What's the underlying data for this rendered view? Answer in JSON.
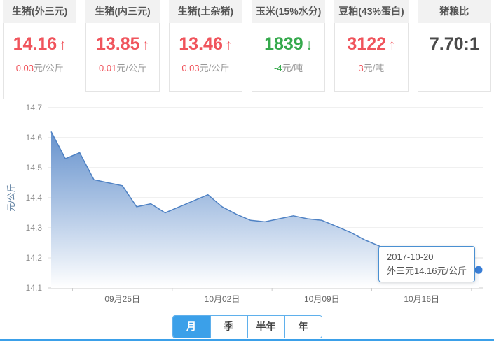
{
  "cards": [
    {
      "title": "生猪(外三元)",
      "value": "14.16",
      "arrow": "↑",
      "trend": "up",
      "change": "0.03",
      "unit": "元/公斤",
      "selected": true
    },
    {
      "title": "生猪(内三元)",
      "value": "13.85",
      "arrow": "↑",
      "trend": "up",
      "change": "0.01",
      "unit": "元/公斤",
      "selected": false
    },
    {
      "title": "生猪(土杂猪)",
      "value": "13.46",
      "arrow": "↑",
      "trend": "up",
      "change": "0.03",
      "unit": "元/公斤",
      "selected": false
    },
    {
      "title": "玉米(15%水分)",
      "value": "1839",
      "arrow": "↓",
      "trend": "down",
      "change": "-4",
      "unit": "元/吨",
      "selected": false
    },
    {
      "title": "豆粕(43%蛋白)",
      "value": "3122",
      "arrow": "↑",
      "trend": "up",
      "change": "3",
      "unit": "元/吨",
      "selected": false
    },
    {
      "title": "猪粮比",
      "value": "7.70:1",
      "trend": "none",
      "selected": false
    }
  ],
  "chart_data": {
    "type": "area",
    "title": "",
    "ylabel": "元/公斤",
    "ylim": [
      14.1,
      14.7
    ],
    "ytick_step": 0.1,
    "grid": true,
    "series": [
      {
        "name": "外三元",
        "values": [
          14.62,
          14.53,
          14.55,
          14.46,
          14.45,
          14.44,
          14.37,
          14.38,
          14.35,
          14.37,
          14.39,
          14.41,
          14.37,
          14.345,
          14.325,
          14.32,
          14.33,
          14.34,
          14.33,
          14.325,
          14.305,
          14.285,
          14.26,
          14.24,
          14.22,
          14.21,
          14.2,
          14.19,
          14.18,
          14.17,
          14.16
        ]
      }
    ],
    "x_ticks": [
      {
        "label": "09月25日",
        "index": 5
      },
      {
        "label": "10月02日",
        "index": 12
      },
      {
        "label": "10月09日",
        "index": 19
      },
      {
        "label": "10月16日",
        "index": 26
      }
    ],
    "last_point": {
      "date": "2017-10-20",
      "value": 14.16
    }
  },
  "tooltip": {
    "date": "2017-10-20",
    "text": "外三元14.16元/公斤"
  },
  "tabs": {
    "items": [
      "月",
      "季",
      "半年",
      "年"
    ],
    "selected": "月"
  },
  "colors": {
    "up": "#f0545c",
    "down": "#35a94c",
    "unit": "#999999",
    "plain": "#4a4a4a",
    "grid": "#e0e0e0",
    "axis": "#cccccc",
    "accent": "#3ba0e9",
    "tabborder": "#5fb0ec",
    "tipborder": "#4a90d2",
    "line": "#4f82c4",
    "fill_top": "#477cc3",
    "fill_bottom": "#ffffff",
    "dot": "#3a7ed6",
    "ylabel_text": "#8e8e8e",
    "xlabel_text": "#666666",
    "ytitle": "#5e7fa0"
  }
}
